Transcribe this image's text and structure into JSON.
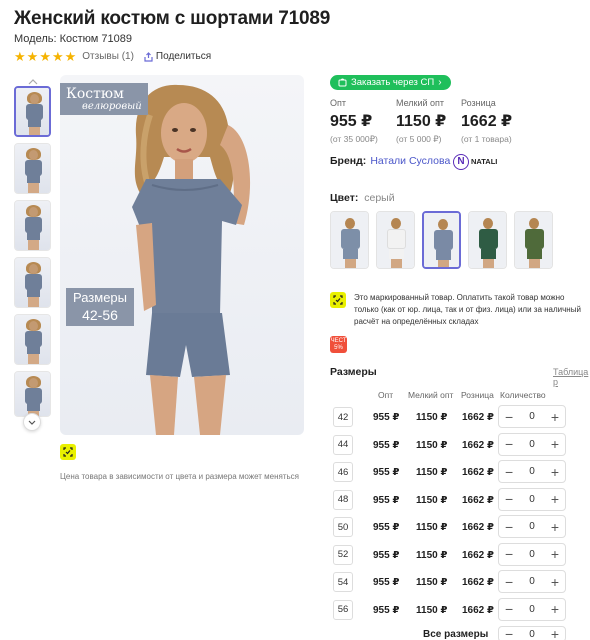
{
  "product": {
    "title": "Женский костюм с шортами 71089",
    "model": "Модель: Костюм 71089",
    "rating_stars": 5,
    "reviews": "Отзывы (1)",
    "share": "Поделиться"
  },
  "gallery": {
    "badge_costume_line1": "Костюм",
    "badge_costume_line2": "велюровый",
    "badge_sizes_line1": "Размеры",
    "badge_sizes_line2": "42-56",
    "note": "Цена товара в зависимости от цвета и размера может меняться"
  },
  "order_button": "Заказать через СП",
  "prices": [
    {
      "label": "Опт",
      "value": "955 ₽",
      "sub": "(от 35 000₽)"
    },
    {
      "label": "Мелкий опт",
      "value": "1150 ₽",
      "sub": "(от 5 000 ₽)"
    },
    {
      "label": "Розница",
      "value": "1662 ₽",
      "sub": "(от 1 товара)"
    }
  ],
  "brand": {
    "label": "Бренд:",
    "value": "Натали Суслова",
    "logo_text": "NATALI"
  },
  "color": {
    "label": "Цвет:",
    "value": "серый"
  },
  "swatch_colors": [
    "#7d8fa8",
    "#f2f2f2",
    "#7a8aa5",
    "#2f5c44",
    "#4f6a3a"
  ],
  "marked_text": "Это маркированный товар. Оплатить такой товар можно только (как от юр. лица, так и от физ. лица) или за наличный расчёт на определённых складах",
  "sale_icon": [
    "ЧЕСТ",
    "5%"
  ],
  "sizes": {
    "title": "Размеры",
    "table_link": "Таблица р",
    "columns": [
      "Опт",
      "Мелкий опт",
      "Розница",
      "Количество"
    ],
    "rows": [
      {
        "size": "42",
        "opt": "955 ₽",
        "small": "1150 ₽",
        "retail": "1662 ₽",
        "qty": "0"
      },
      {
        "size": "44",
        "opt": "955 ₽",
        "small": "1150 ₽",
        "retail": "1662 ₽",
        "qty": "0"
      },
      {
        "size": "46",
        "opt": "955 ₽",
        "small": "1150 ₽",
        "retail": "1662 ₽",
        "qty": "0"
      },
      {
        "size": "48",
        "opt": "955 ₽",
        "small": "1150 ₽",
        "retail": "1662 ₽",
        "qty": "0"
      },
      {
        "size": "50",
        "opt": "955 ₽",
        "small": "1150 ₽",
        "retail": "1662 ₽",
        "qty": "0"
      },
      {
        "size": "52",
        "opt": "955 ₽",
        "small": "1150 ₽",
        "retail": "1662 ₽",
        "qty": "0"
      },
      {
        "size": "54",
        "opt": "955 ₽",
        "small": "1150 ₽",
        "retail": "1662 ₽",
        "qty": "0"
      },
      {
        "size": "56",
        "opt": "955 ₽",
        "small": "1150 ₽",
        "retail": "1662 ₽",
        "qty": "0"
      }
    ],
    "all_sizes_label": "Все размеры",
    "all_sizes_qty": "0"
  },
  "stepper": {
    "minus": "−",
    "plus": "+"
  }
}
